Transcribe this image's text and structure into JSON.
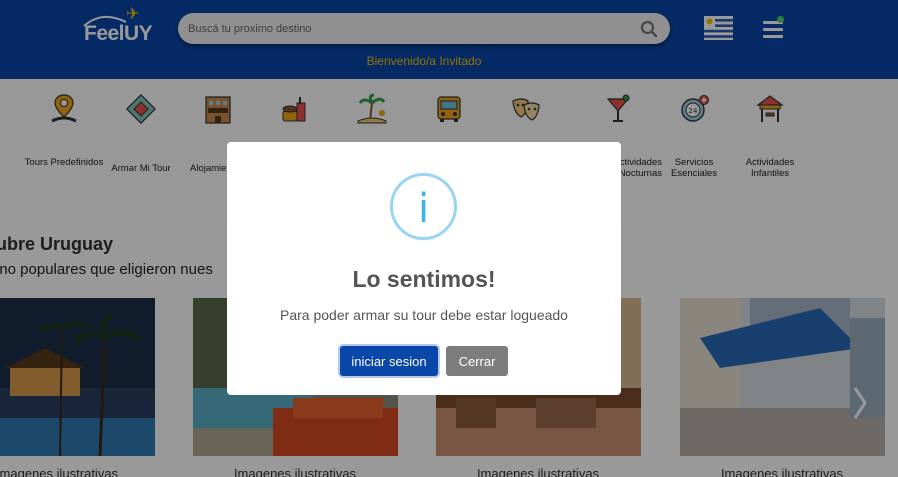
{
  "header": {
    "logo_text": "FeelUY",
    "search_placeholder": "Buscá tu proximo destino",
    "welcome": "Bienvenido/a Invitado",
    "colors": {
      "bar": "#0a47a8",
      "accent": "#f2c200"
    }
  },
  "categories": [
    {
      "label": "Tours Predefinidos",
      "icon": "map-pin-icon"
    },
    {
      "label": "Armar Mi Tour",
      "icon": "map-pieces-icon"
    },
    {
      "label": "Alojamientos",
      "icon": "hotel-icon"
    },
    {
      "label": "",
      "icon": "food-icon"
    },
    {
      "label": "",
      "icon": "beach-icon"
    },
    {
      "label": "",
      "icon": "bus-icon"
    },
    {
      "label": "",
      "icon": "theater-masks-icon"
    },
    {
      "label": "Actividades Nocturnas",
      "icon": "cocktail-icon"
    },
    {
      "label": "Servicios Esenciales",
      "icon": "24h-service-icon"
    },
    {
      "label": "Actividades Infantiles",
      "icon": "playground-icon"
    }
  ],
  "section": {
    "title": "ubre Uruguay",
    "subtitle": "ino populares que eligieron nues"
  },
  "cards": [
    {
      "caption": "Imagenes ilustrativas"
    },
    {
      "caption": "Imagenes ilustrativas"
    },
    {
      "caption": "Imagenes ilustrativas"
    },
    {
      "caption": "Imagenes ilustrativas"
    }
  ],
  "modal": {
    "icon": "info-icon",
    "icon_glyph": "i",
    "title": "Lo sentimos!",
    "message": "Para poder armar su tour debe estar logueado",
    "primary_button": "iniciar sesion",
    "secondary_button": "Cerrar"
  }
}
